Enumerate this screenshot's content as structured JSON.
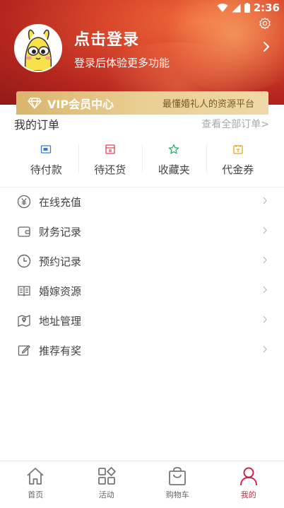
{
  "status_bar": {
    "time": "2:36"
  },
  "header": {
    "login_title": "点击登录",
    "login_subtitle": "登录后体验更多功能"
  },
  "vip": {
    "title": "VIP会员中心",
    "slogan": "最懂婚礼人的资源平台"
  },
  "orders": {
    "title": "我的订单",
    "view_all": "查看全部订单>",
    "tabs": [
      {
        "label": "待付款",
        "icon": "wallet-card-icon",
        "color": "#3a7bd5"
      },
      {
        "label": "待还货",
        "icon": "return-box-icon",
        "color": "#e8414e"
      },
      {
        "label": "收藏夹",
        "icon": "star-icon",
        "color": "#2fb36a"
      },
      {
        "label": "代金券",
        "icon": "voucher-icon",
        "color": "#e6a321"
      }
    ]
  },
  "menu": {
    "items": [
      {
        "label": "在线充值",
        "icon": "yen-coin-icon"
      },
      {
        "label": "财务记录",
        "icon": "wallet-icon"
      },
      {
        "label": "预约记录",
        "icon": "clock-icon"
      },
      {
        "label": "婚嫁资源",
        "icon": "book-icon"
      },
      {
        "label": "地址管理",
        "icon": "map-pin-icon"
      },
      {
        "label": "推荐有奖",
        "icon": "edit-note-icon"
      }
    ]
  },
  "bottom_nav": {
    "items": [
      {
        "label": "首页",
        "icon": "home-icon"
      },
      {
        "label": "活动",
        "icon": "apps-grid-icon"
      },
      {
        "label": "购物车",
        "icon": "shopping-bag-icon"
      },
      {
        "label": "我的",
        "icon": "user-icon",
        "active": true
      }
    ]
  },
  "colors": {
    "accent": "#d6224a",
    "header": "#c8352a",
    "vip_gold": "#e3c485"
  }
}
